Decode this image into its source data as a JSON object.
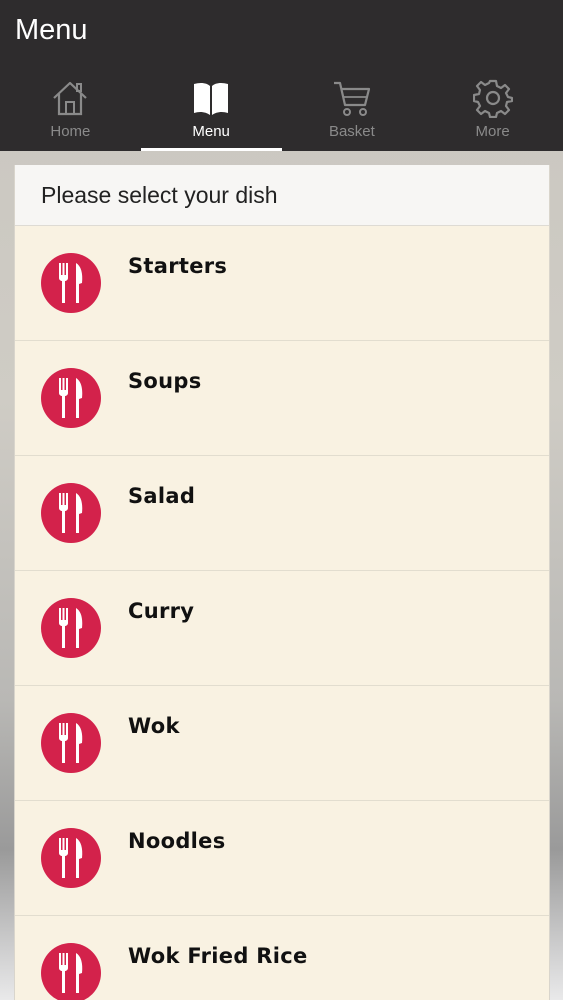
{
  "header": {
    "title": "Menu"
  },
  "tabs": [
    {
      "label": "Home",
      "icon": "home-icon",
      "active": false
    },
    {
      "label": "Menu",
      "icon": "book-icon",
      "active": true
    },
    {
      "label": "Basket",
      "icon": "cart-icon",
      "active": false
    },
    {
      "label": "More",
      "icon": "gear-icon",
      "active": false
    }
  ],
  "panel": {
    "title": "Please select your dish"
  },
  "dishes": [
    {
      "name": "Starters"
    },
    {
      "name": "Soups"
    },
    {
      "name": "Salad"
    },
    {
      "name": "Curry"
    },
    {
      "name": "Wok"
    },
    {
      "name": "Noodles"
    },
    {
      "name": "Wok Fried Rice"
    }
  ],
  "colors": {
    "header_bg": "#2e2c2d",
    "icon_red": "#d3224b",
    "row_bg": "#f9f2e2"
  }
}
